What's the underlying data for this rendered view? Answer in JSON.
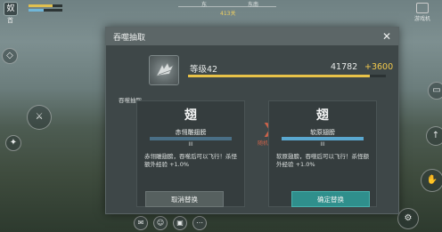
{
  "hud": {
    "avatar_label": "奴",
    "coins_label": "首"
  },
  "compass": {
    "label_east": "东",
    "label_southeast": "东南",
    "bearing": "413关"
  },
  "shop": {
    "label": "游戏机"
  },
  "dialog": {
    "title": "吞噬抽取",
    "close_glyph": "✕",
    "level_label": "等级42",
    "exp_current": "41782",
    "exp_gain": "+3600",
    "exp_progress": 0.92,
    "section_title": "吞噬抽取",
    "left_skill": {
      "icon_glyph": "翅",
      "name": "赤翎雕翅膀",
      "level": "III",
      "description": "赤翎雕翅膀，吞噬后可以飞行！杀怪额外经验 +1.0%"
    },
    "right_skill": {
      "icon_glyph": "翅",
      "name": "软原翅膀",
      "level": "III",
      "description": "软原翅膀，吞噬后可以飞行！杀怪额外经验 +1.0%"
    },
    "arrow_label": "随机替换",
    "cancel_label": "取消替换",
    "confirm_label": "确定替换"
  },
  "colors": {
    "gain": "#f2c94c",
    "confirm": "#2f8f8c",
    "arrow": "#c9624a"
  }
}
